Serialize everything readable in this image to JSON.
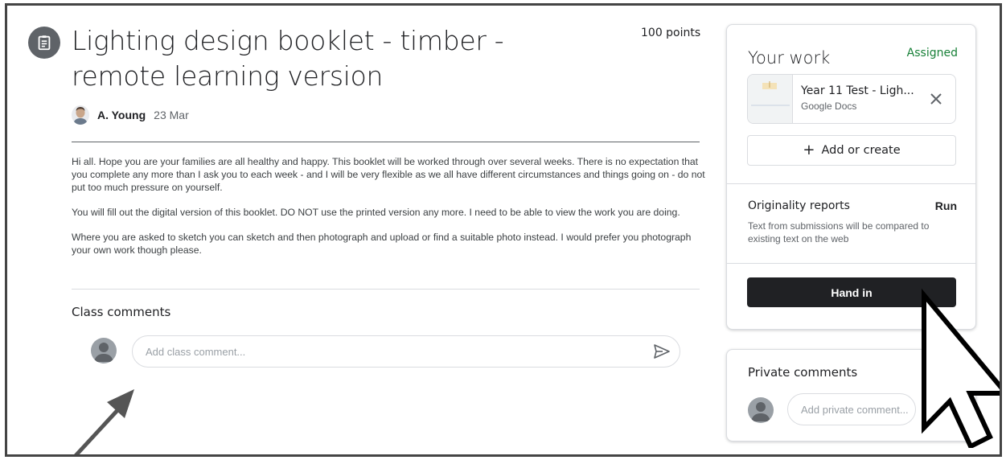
{
  "assignment": {
    "title": "Lighting design booklet - timber - remote learning version",
    "points": "100 points",
    "author": "A. Young",
    "date": "23 Mar",
    "description": [
      "Hi all. Hope you are your families are all healthy and happy. This booklet will be worked through over several weeks. There is no expectation that you complete any more than I ask you to each week - and I will be very flexible as we all have different circumstances and things going on - do not put too much pressure on yourself.",
      "You will fill out the digital version of this booklet. DO NOT use the printed version any more. I need to be able to view the work you are doing.",
      "Where you are asked to sketch you can sketch and then photograph and upload or find a suitable photo instead. I would prefer you photograph your own work though please."
    ]
  },
  "class_comments": {
    "label": "Class comments",
    "placeholder": "Add class comment..."
  },
  "your_work": {
    "title": "Your work",
    "status": "Assigned",
    "attachment": {
      "name": "Year 11 Test - Ligh...",
      "type": "Google Docs"
    },
    "add_create_label": "Add or create",
    "originality": {
      "label": "Originality reports",
      "action": "Run",
      "description": "Text from submissions will be compared to existing text on the web"
    },
    "hand_in_label": "Hand in"
  },
  "private_comments": {
    "title": "Private comments",
    "placeholder": "Add private comment..."
  },
  "colors": {
    "assigned": "#188038",
    "hand_in_bg": "#202124"
  },
  "icons": [
    "assignment-icon",
    "send-icon",
    "close-icon",
    "plus-icon",
    "avatar-icon",
    "arrow-annotation",
    "mouse-cursor"
  ]
}
